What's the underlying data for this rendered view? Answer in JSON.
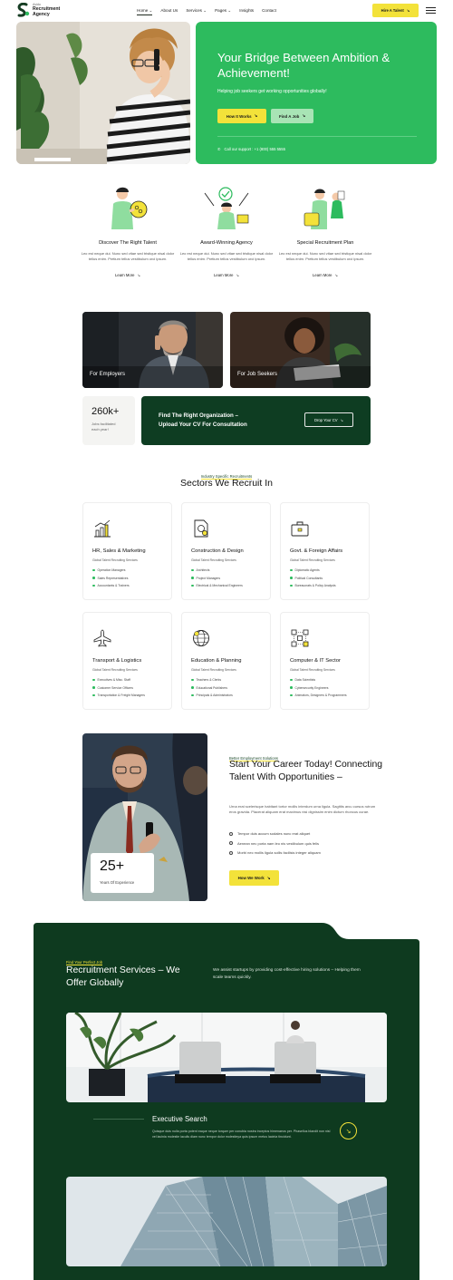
{
  "nav": {
    "logo_small": "Avido",
    "logo_line1": "Recruitment",
    "logo_line2": "Agency",
    "items": [
      {
        "label": "Home",
        "has_dropdown": true,
        "active": true
      },
      {
        "label": "About Us",
        "has_dropdown": false
      },
      {
        "label": "Services",
        "has_dropdown": true
      },
      {
        "label": "Pages",
        "has_dropdown": true
      },
      {
        "label": "Insights",
        "has_dropdown": false
      },
      {
        "label": "Contact",
        "has_dropdown": false
      }
    ],
    "hire_label": "Hire A Talent",
    "icons": {
      "hire": "arrow-down-right-icon",
      "menu": "hamburger-menu-icon",
      "dropdown": "chevron-down-icon"
    }
  },
  "hero": {
    "title": "Your Bridge Between Ambition & Achievement!",
    "subtitle": "Helping job seekers get working opportunities globally!",
    "btn_primary": "How It Works",
    "btn_secondary": "Find A Job",
    "support": "Call our support : +1 (800) 555 5555",
    "icons": {
      "phone": "phone-icon",
      "button": "arrow-down-right-icon"
    }
  },
  "features": [
    {
      "title": "Discover The Right Talent",
      "text": "Leo est neque dui. Nunc sed vitae sed tristique nisal dolor tellus enim. Pretium tellus vestibulum orci ipsum.",
      "link": "Learn More"
    },
    {
      "title": "Award-Winning Agency",
      "text": "Leo est neque dui. Nunc sed vitae sed tristique nisal dolor tellus enim. Pretium tellus vestibulum orci ipsum.",
      "link": "Learn More"
    },
    {
      "title": "Special Recruitment Plan",
      "text": "Leo est neque dui. Nunc sed vitae sed tristique nisal dolor tellus enim. Pretium tellus vestibulum orci ipsum.",
      "link": "Learn More"
    }
  ],
  "audience": {
    "employers_label": "For Employers",
    "seekers_label": "For Job Seekers",
    "stat_value": "260k+",
    "stat_text": "Jobs facilitated each year!",
    "cta_title_line1": "Find The Right Organization –",
    "cta_title_line2": "Upload Your CV For Consultation",
    "cta_button": "Drop Your CV"
  },
  "sectors": {
    "tag": "Industry Specific Recruitments",
    "title": "Sectors We Recruit In",
    "items": [
      {
        "title": "HR, Sales & Marketing",
        "sub": "Global Talent Recruiting Services",
        "icon": "bar-chart-icon",
        "list": [
          "Operation Managers",
          "Sales Representatives",
          "Accountants & Trainers"
        ]
      },
      {
        "title": "Construction & Design",
        "sub": "Global Talent Recruiting Services",
        "icon": "blueprint-document-icon",
        "list": [
          "Architects",
          "Project Managers",
          "Electrical & Mechanical Engineers"
        ]
      },
      {
        "title": "Govt. & Foreign Affairs",
        "sub": "Global Talent Recruiting Services",
        "icon": "briefcase-icon",
        "list": [
          "Diplomatic Agents",
          "Political Consultants",
          "Bureaucrats & Policy Analysts"
        ]
      },
      {
        "title": "Transport & Logistics",
        "sub": "Global Talent Recruiting Services",
        "icon": "airplane-icon",
        "list": [
          "Executives & Misc. Staff",
          "Customer Service Officers",
          "Transportation & Freight Managers"
        ]
      },
      {
        "title": "Education & Planning",
        "sub": "Global Talent Recruiting Services",
        "icon": "globe-icon",
        "list": [
          "Teachers & Clerks",
          "Educational Publishers",
          "Principals & Administrators"
        ]
      },
      {
        "title": "Computer & IT Sector",
        "sub": "Global Talent Recruiting Services",
        "icon": "network-nodes-icon",
        "list": [
          "Data Scientists",
          "Cybersecurity Engineers",
          "Animators, Designers & Programmers"
        ]
      }
    ]
  },
  "career": {
    "exp_value": "25+",
    "exp_label": "Years Of Experience",
    "tag": "Better Employment Solutions",
    "title": "Start Your Career Today! Connecting Talent With Opportunities –",
    "body": "Urna erat scelerisque habitant tortor mollis interdum urna ligula. Sagittis arcu cursus rutrum eros gravida. Placerat aliquam erat maximus nisi dignissim enim dictum rhoncus curae.",
    "checks": [
      "Tempor duis accum sodales nunc erat aliquet",
      "Aenean nec porta nam leo nis vestibulum quis felis",
      "Morbi nec mollis ligula sollis facilisis integer aliquam"
    ],
    "button": "How We Work"
  },
  "services": {
    "tag": "Find Your Perfect Job",
    "title": "Recruitment Services – We Offer Globally",
    "body": "We assist startups by providing cost-effective hiring solutions – Helping them scale teams quickly.",
    "exec_title": "Executive Search",
    "exec_body": "Quisque duis nulla porta potent eaque neque torquer per conubia nostra inceptos himenaeos per. Phasellus blandit non nisl vel lacinia molestie iaculis diam nunc tempor dolor molestieya quis ipsum metus lacinia tincidunt."
  },
  "colors": {
    "primary_green": "#2dbb5e",
    "dark_green": "#0e3a1f",
    "accent_yellow": "#f3e23a"
  }
}
